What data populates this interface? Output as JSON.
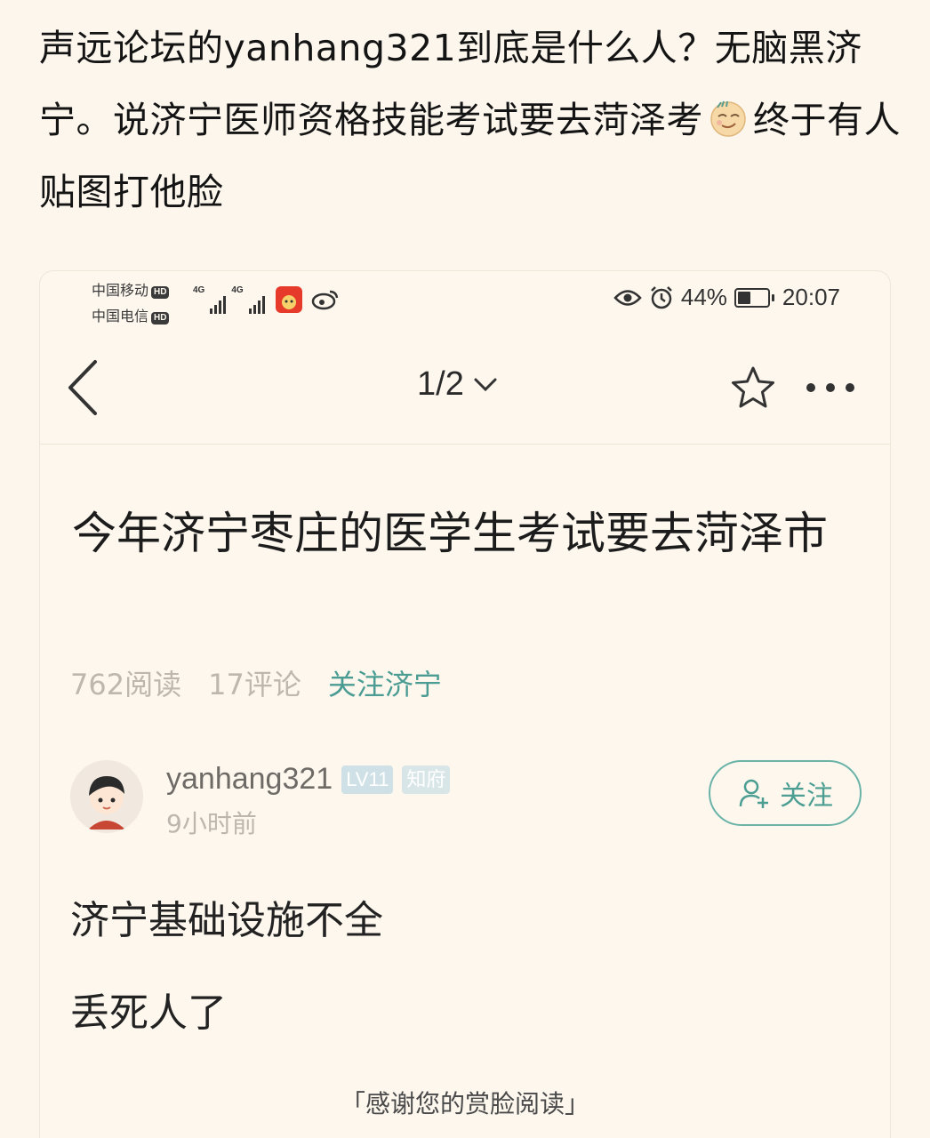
{
  "post": {
    "title_part1": "声远论坛的yanhang321到底是什么人？无脑黑济宁。说济宁医师资格技能考试要去菏泽考",
    "title_part2": "终于有人贴图打他脸",
    "emoji_icon": "smirk-emoji-icon"
  },
  "statusbar": {
    "carrier1": "中国移动",
    "carrier2": "中国电信",
    "hd_label": "HD",
    "net1": "4G",
    "net2": "4G",
    "battery_percent": "44%",
    "battery_level": 0.44,
    "time": "20:07"
  },
  "navbar": {
    "pager": "1/2",
    "back_icon": "chevron-left-icon",
    "fav_icon": "star-icon",
    "more_icon": "more-dots-icon"
  },
  "article": {
    "title": "今年济宁枣庄的医学生考试要去菏泽市",
    "reads": "762阅读",
    "comments": "17评论",
    "follow_topic": "关注济宁"
  },
  "author": {
    "name": "yanhang321",
    "level": "LV11",
    "role": "知府",
    "time": "9小时前",
    "follow_label": "关注"
  },
  "content": {
    "p1": "济宁基础设施不全",
    "p2": "丢死人了"
  },
  "footer": {
    "note": "「感谢您的赏脸阅读」"
  },
  "colors": {
    "background": "#fcf6ed",
    "accent_teal": "#4c9e93",
    "meta_gray": "#bdb7ae"
  }
}
